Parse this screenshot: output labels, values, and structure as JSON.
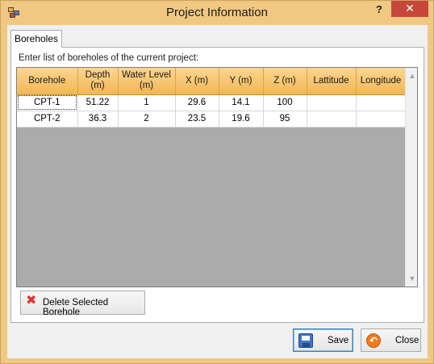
{
  "window": {
    "title": "Project Information",
    "help_glyph": "?",
    "close_glyph": "✕"
  },
  "tabs": [
    {
      "label": "Boreholes"
    }
  ],
  "panel": {
    "instructions": "Enter list of boreholes of the current project:"
  },
  "grid": {
    "columns": [
      {
        "line1": "Borehole",
        "line2": ""
      },
      {
        "line1": "Depth",
        "line2": "(m)"
      },
      {
        "line1": "Water Level",
        "line2": "(m)"
      },
      {
        "line1": "X (m)",
        "line2": ""
      },
      {
        "line1": "Y (m)",
        "line2": ""
      },
      {
        "line1": "Z (m)",
        "line2": ""
      },
      {
        "line1": "Lattitude",
        "line2": ""
      },
      {
        "line1": "Longitude",
        "line2": ""
      }
    ],
    "rows": [
      [
        "CPT-1",
        "51.22",
        "1",
        "29.6",
        "14.1",
        "100",
        "",
        ""
      ],
      [
        "CPT-2",
        "36.3",
        "2",
        "23.5",
        "19.6",
        "95",
        "",
        ""
      ]
    ],
    "scroll_up_glyph": "▲",
    "scroll_down_glyph": "▼"
  },
  "buttons": {
    "delete_label": "Delete Selected Borehole",
    "delete_icon": "✖",
    "save_label": "Save",
    "close_label": "Close"
  },
  "icons": {
    "app": "app-icon",
    "delete": "red-x-icon",
    "save": "floppy-disk-icon",
    "close": "undo-arrow-icon"
  }
}
